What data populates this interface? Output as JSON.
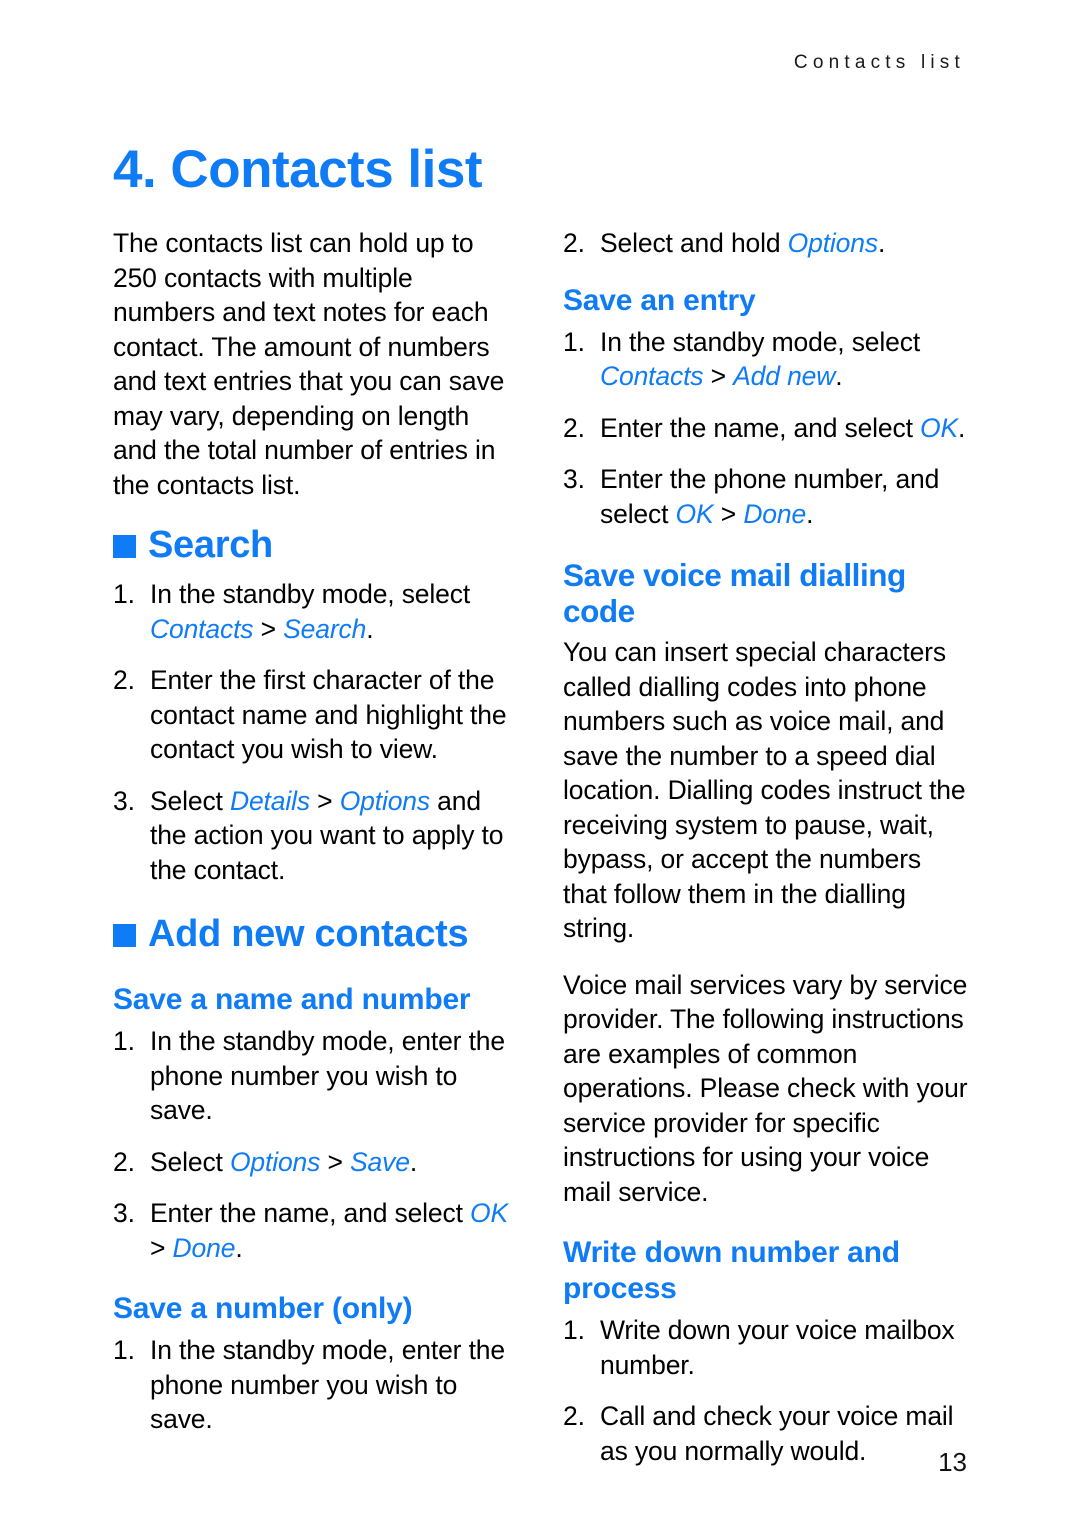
{
  "header": {
    "running_title": "Contacts list"
  },
  "chapter": {
    "title": "4. Contacts list"
  },
  "page_number": "13",
  "colors": {
    "accent_blue": "#0f7cf5",
    "text_black": "#000000"
  },
  "left_column": {
    "intro_paragraph": "The contacts list can hold up to 250 contacts with multiple numbers and text notes for each contact. The amount of numbers and text entries that you can save may vary, depending on length and the total number of entries in the contacts list.",
    "search_section": {
      "heading": "Search",
      "steps": [
        {
          "number": "1.",
          "parts": [
            {
              "text": "In the standby mode, select ",
              "style": "plain"
            },
            {
              "text": "Contacts",
              "style": "ui"
            },
            {
              "text": " > ",
              "style": "sep"
            },
            {
              "text": "Search",
              "style": "ui"
            },
            {
              "text": ".",
              "style": "plain"
            }
          ]
        },
        {
          "number": "2.",
          "parts": [
            {
              "text": "Enter the first character of the contact name and highlight the contact you wish to view.",
              "style": "plain"
            }
          ]
        },
        {
          "number": "3.",
          "parts": [
            {
              "text": "Select ",
              "style": "plain"
            },
            {
              "text": "Details",
              "style": "ui"
            },
            {
              "text": " > ",
              "style": "sep"
            },
            {
              "text": "Options",
              "style": "ui"
            },
            {
              "text": " and the action you want to apply to the contact.",
              "style": "plain"
            }
          ]
        }
      ]
    },
    "add_new_contacts_section": {
      "heading": "Add new contacts",
      "save_name_and_number": {
        "heading": "Save a name and number",
        "steps": [
          {
            "number": "1.",
            "parts": [
              {
                "text": "In the standby mode, enter the phone number you wish to save.",
                "style": "plain"
              }
            ]
          },
          {
            "number": "2.",
            "parts": [
              {
                "text": "Select ",
                "style": "plain"
              },
              {
                "text": "Options",
                "style": "ui"
              },
              {
                "text": " > ",
                "style": "sep"
              },
              {
                "text": "Save",
                "style": "ui"
              },
              {
                "text": ".",
                "style": "plain"
              }
            ]
          },
          {
            "number": "3.",
            "parts": [
              {
                "text": "Enter the name, and select ",
                "style": "plain"
              },
              {
                "text": "OK",
                "style": "ui"
              },
              {
                "text": " > ",
                "style": "sep"
              },
              {
                "text": "Done",
                "style": "ui"
              },
              {
                "text": ".",
                "style": "plain"
              }
            ]
          }
        ]
      },
      "save_number_only": {
        "heading": "Save a number (only)",
        "steps": [
          {
            "number": "1.",
            "parts": [
              {
                "text": "In the standby mode, enter the phone number you wish to save.",
                "style": "plain"
              }
            ]
          }
        ]
      }
    }
  },
  "right_column": {
    "continued_step": {
      "number": "2.",
      "parts": [
        {
          "text": "Select and hold ",
          "style": "plain"
        },
        {
          "text": "Options",
          "style": "ui"
        },
        {
          "text": ".",
          "style": "plain"
        }
      ]
    },
    "save_an_entry": {
      "heading": "Save an entry",
      "steps": [
        {
          "number": "1.",
          "parts": [
            {
              "text": "In the standby mode, select ",
              "style": "plain"
            },
            {
              "text": "Contacts",
              "style": "ui"
            },
            {
              "text": " > ",
              "style": "sep"
            },
            {
              "text": "Add new",
              "style": "ui"
            },
            {
              "text": ".",
              "style": "plain"
            }
          ]
        },
        {
          "number": "2.",
          "parts": [
            {
              "text": "Enter the name, and select ",
              "style": "plain"
            },
            {
              "text": "OK",
              "style": "ui"
            },
            {
              "text": ".",
              "style": "plain"
            }
          ]
        },
        {
          "number": "3.",
          "parts": [
            {
              "text": "Enter the phone number, and select ",
              "style": "plain"
            },
            {
              "text": "OK",
              "style": "ui"
            },
            {
              "text": " > ",
              "style": "sep"
            },
            {
              "text": "Done",
              "style": "ui"
            },
            {
              "text": ".",
              "style": "plain"
            }
          ]
        }
      ]
    },
    "save_voice_mail_dialling_code": {
      "heading": "Save voice mail dialling code",
      "paragraph_1": "You can insert special characters called dialling codes into phone numbers such as voice mail, and save the number to a speed dial location. Dialling codes instruct the receiving system to pause, wait, bypass, or accept the numbers that follow them in the dialling string.",
      "paragraph_2": "Voice mail services vary by service provider. The following instructions are examples of common operations. Please check with your service provider for specific instructions for using your voice mail service."
    },
    "write_down_number_and_process": {
      "heading": "Write down number and process",
      "steps": [
        {
          "number": "1.",
          "parts": [
            {
              "text": "Write down your voice mailbox number.",
              "style": "plain"
            }
          ]
        },
        {
          "number": "2.",
          "parts": [
            {
              "text": "Call and check your voice mail as you normally would.",
              "style": "plain"
            }
          ]
        }
      ]
    }
  }
}
